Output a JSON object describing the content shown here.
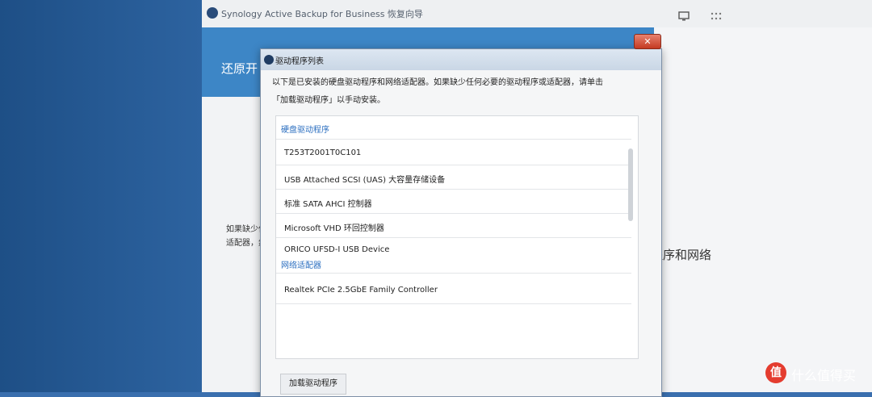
{
  "app": {
    "title": "Synology Active Backup for Business 恢复向导",
    "banner_title": "还原开",
    "side_text_1": "如果缺少任",
    "side_text_2": "适配器，然"
  },
  "right_panel": {
    "text": "程序和网络"
  },
  "dialog": {
    "title": "驱动程序列表",
    "close_label": "✕",
    "description_line1": "以下是已安装的硬盘驱动程序和网络适配器。如果缺少任何必要的驱动程序或适配器，请单击",
    "description_line2": "「加载驱动程序」以手动安装。",
    "sections": [
      {
        "title": "硬盘驱动程序",
        "items": [
          "T253T2001T0C101",
          "USB Attached SCSI (UAS) 大容量存储设备",
          "标准 SATA AHCI 控制器",
          "Microsoft VHD 环回控制器",
          "ORICO UFSD-I USB Device"
        ]
      },
      {
        "title": "网络适配器",
        "items": [
          "Realtek PCIe 2.5GbE Family Controller"
        ]
      }
    ],
    "load_button": "加载驱动程序"
  },
  "watermark": {
    "logo_text": "值",
    "text": "什么值得买"
  }
}
